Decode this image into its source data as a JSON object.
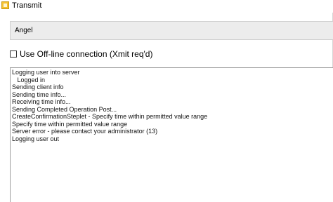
{
  "window": {
    "title": "Transmit"
  },
  "user": {
    "name": "Angel"
  },
  "offline": {
    "label": "Use Off-line connection (Xmit req'd)",
    "checked": false
  },
  "log": {
    "lines": [
      "Logging user into server",
      "   Logged in",
      "Sending client info",
      "Sending time info...",
      "Receiving time info...",
      "Sending Completed Operation Post...",
      "CreateConfirmationSteplet - Specify time within permitted value range",
      "Specify time within permitted value range",
      "Server error - please contact your administrator (13)",
      "Logging user out"
    ]
  },
  "icons": {
    "app": "transmit-app-icon"
  }
}
